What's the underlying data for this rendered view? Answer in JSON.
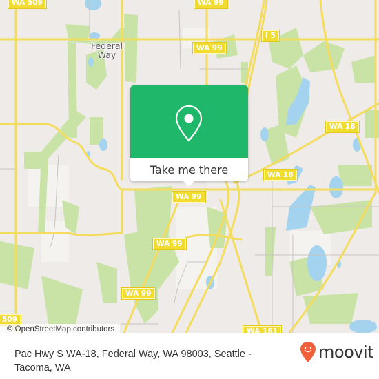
{
  "map": {
    "place_labels": [
      {
        "name": "Federal Way"
      }
    ],
    "road_shields": [
      {
        "id": "wa509-top",
        "label": "WA 509"
      },
      {
        "id": "wa99-top",
        "label": "WA 99"
      },
      {
        "id": "wa99-mid",
        "label": "WA 99"
      },
      {
        "id": "i5",
        "label": "I 5"
      },
      {
        "id": "wa18-right",
        "label": "WA 18"
      },
      {
        "id": "wa18-center",
        "label": "WA 18"
      },
      {
        "id": "wa99-center",
        "label": "WA 99"
      },
      {
        "id": "wa99-lower",
        "label": "WA 99"
      },
      {
        "id": "wa99-bottom",
        "label": "WA 99"
      },
      {
        "id": "509-bottom",
        "label": "509"
      },
      {
        "id": "wa161",
        "label": "WA 161"
      }
    ],
    "attribution": "© OpenStreetMap contributors",
    "colors": {
      "land": "#efebe8",
      "park": "#c9e3a6",
      "water": "#a3d3ef",
      "road": "#f3dc5e",
      "shield": "#f1dc31"
    }
  },
  "popup": {
    "icon": "map-pin-icon",
    "button_label": "Take me there",
    "color": "#1fb86b"
  },
  "footer": {
    "address": "Pac Hwy S WA-18, Federal Way, WA 98003, Seattle - Tacoma, WA",
    "logo_text": "moovit",
    "logo_color": "#f0603a"
  }
}
